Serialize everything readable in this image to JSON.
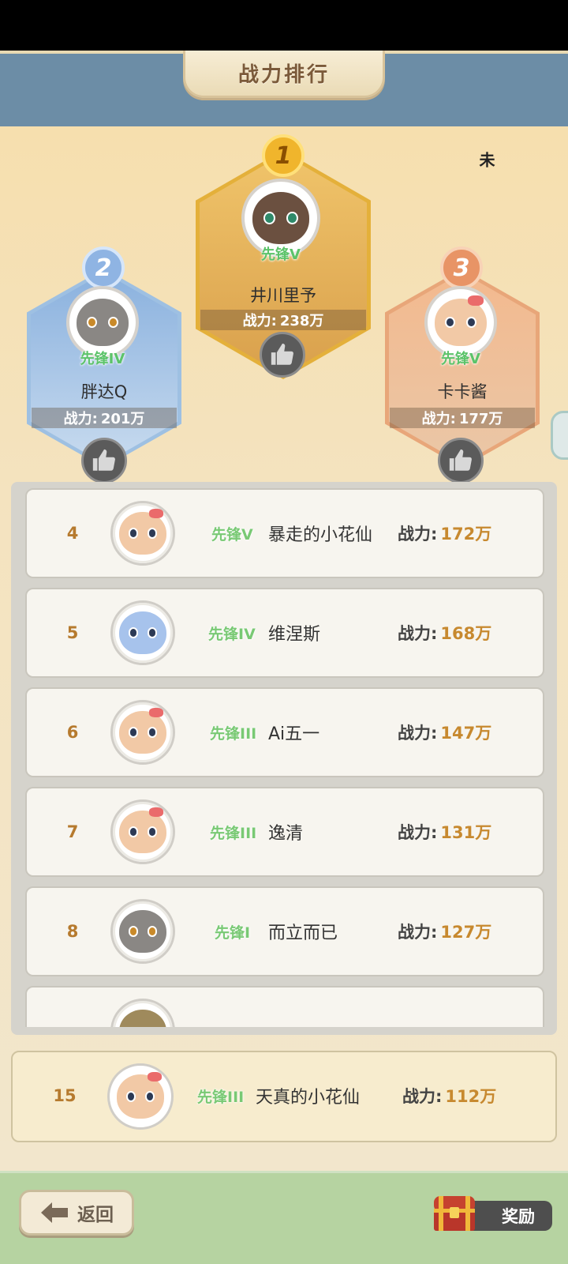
{
  "header": {
    "title": "战力排行"
  },
  "side_text": "未",
  "podium": [
    {
      "rank": "1",
      "tag": "先锋V",
      "name": "井川里予",
      "power_label": "战力:",
      "power_value": "238万"
    },
    {
      "rank": "2",
      "tag": "先锋IV",
      "name": "胖达Q",
      "power_label": "战力:",
      "power_value": "201万"
    },
    {
      "rank": "3",
      "tag": "先锋V",
      "name": "卡卡酱",
      "power_label": "战力:",
      "power_value": "177万"
    }
  ],
  "list": [
    {
      "rank": "4",
      "tag": "先锋V",
      "name": "暴走的小花仙",
      "power_label": "战力:",
      "power_value": "172万",
      "avatar": "cat-bow"
    },
    {
      "rank": "5",
      "tag": "先锋IV",
      "name": "维涅斯",
      "power_label": "战力:",
      "power_value": "168万",
      "avatar": "fairy"
    },
    {
      "rank": "6",
      "tag": "先锋III",
      "name": "Ai五一",
      "power_label": "战力:",
      "power_value": "147万",
      "avatar": "cat-bow"
    },
    {
      "rank": "7",
      "tag": "先锋III",
      "name": "逸清",
      "power_label": "战力:",
      "power_value": "131万",
      "avatar": "cat-bow"
    },
    {
      "rank": "8",
      "tag": "先锋I",
      "name": "而立而已",
      "power_label": "战力:",
      "power_value": "127万",
      "avatar": "cat-gray"
    }
  ],
  "self": {
    "rank": "15",
    "tag": "先锋III",
    "name": "天真的小花仙",
    "power_label": "战力:",
    "power_value": "112万"
  },
  "footer": {
    "back_label": "返回",
    "reward_label": "奖励"
  },
  "colors": {
    "accent_gold": "#c7892f",
    "tag_green": "#79c974",
    "header_blue": "#6c8da6",
    "footer_green": "#b6d3a1"
  },
  "icons": [
    "thumbs-up-icon",
    "back-arrow-icon",
    "treasure-chest-icon"
  ]
}
